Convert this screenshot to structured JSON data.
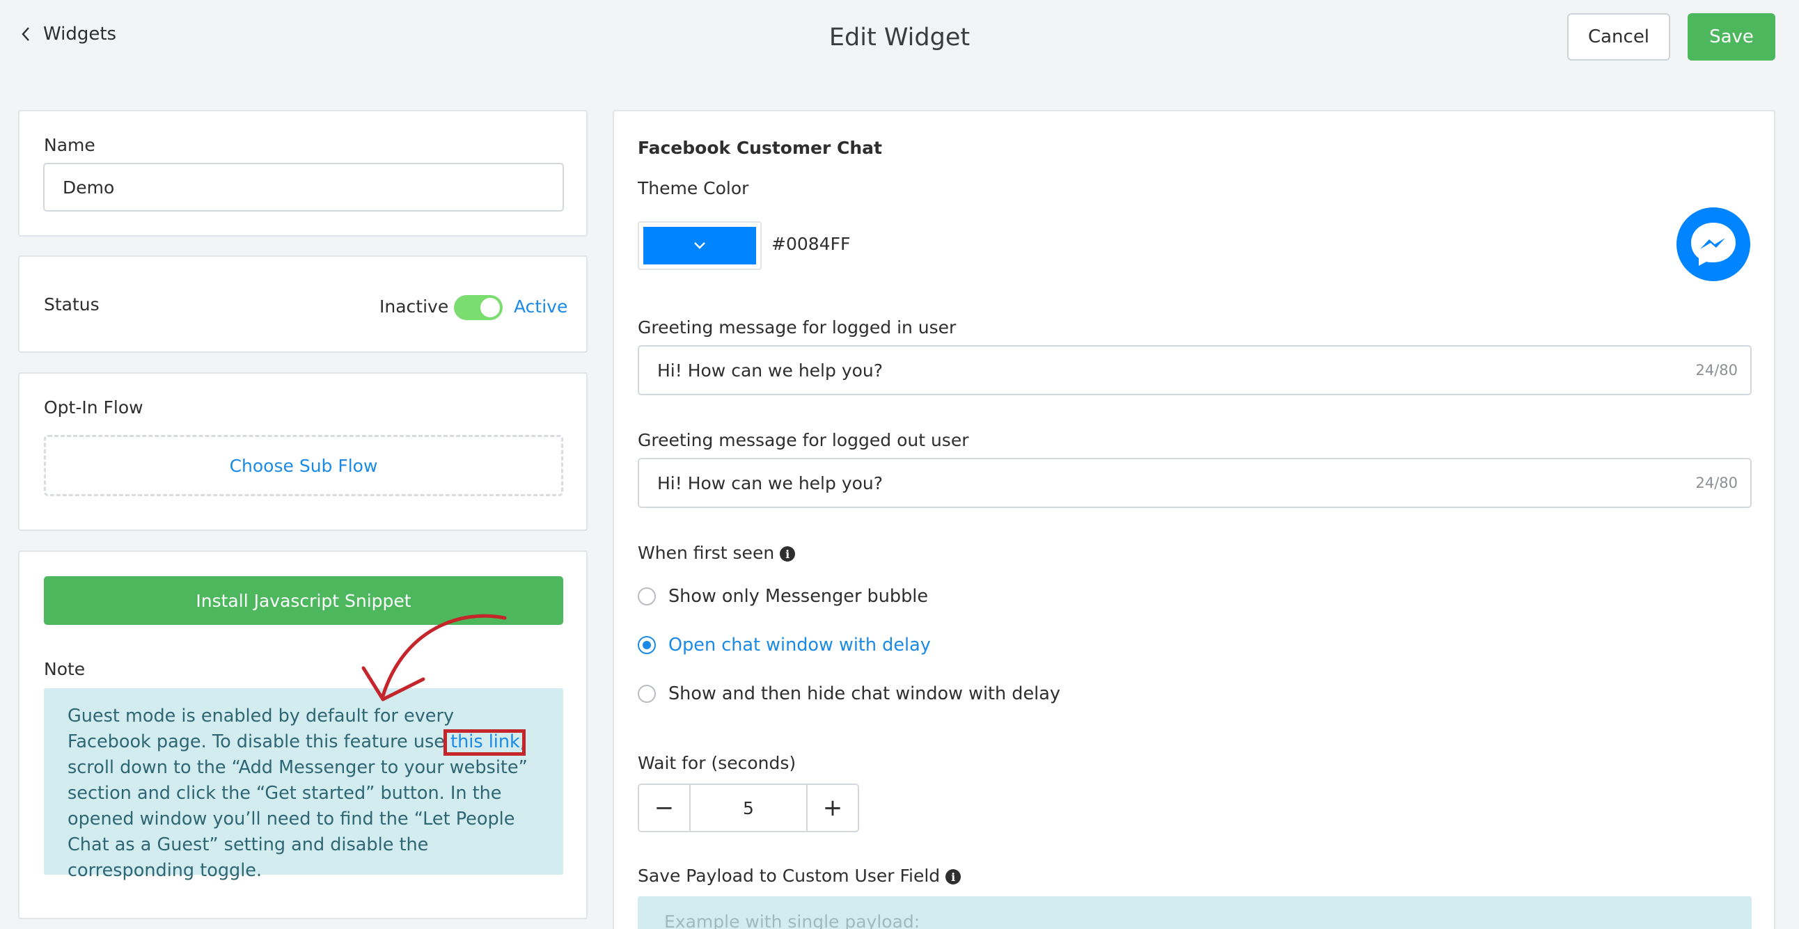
{
  "header": {
    "back_label": "Widgets",
    "title": "Edit Widget",
    "cancel_label": "Cancel",
    "save_label": "Save"
  },
  "name_card": {
    "label": "Name",
    "value": "Demo"
  },
  "status_card": {
    "label": "Status",
    "inactive_label": "Inactive",
    "active_label": "Active",
    "is_active": true
  },
  "optin_card": {
    "label": "Opt-In Flow",
    "choose_label": "Choose Sub Flow"
  },
  "install_card": {
    "install_button_label": "Install Javascript Snippet",
    "note_label": "Note",
    "note_text_before": "Guest mode is enabled by default for every Facebook page. To disable this feature use ",
    "note_link_text": "this link",
    "note_text_after": ", scroll down to the “Add Messenger to your website” section and click the “Get started” button. In the opened window you’ll need to find the “Let People Chat as a Guest” setting and disable the corresponding toggle."
  },
  "fb_chat": {
    "section_title": "Facebook Customer Chat",
    "theme_color_label": "Theme Color",
    "theme_color_hex": "#0084FF",
    "greeting_logged_in_label": "Greeting message for logged in user",
    "greeting_logged_in_value": "Hi! How can we help you?",
    "greeting_logged_in_counter": "24/80",
    "greeting_logged_out_label": "Greeting message for logged out user",
    "greeting_logged_out_value": "Hi! How can we help you?",
    "greeting_logged_out_counter": "24/80",
    "first_seen_label": "When first seen",
    "first_seen_options": [
      {
        "label": "Show only Messenger bubble",
        "selected": false
      },
      {
        "label": "Open chat window with delay",
        "selected": true
      },
      {
        "label": "Show and then hide chat window with delay",
        "selected": false
      }
    ],
    "wait_label": "Wait for (seconds)",
    "wait_value": "5",
    "wait_minus": "−",
    "wait_plus": "+",
    "payload_label": "Save Payload to Custom User Field",
    "payload_placeholder": "Example with single payload:"
  },
  "colors": {
    "accent_blue": "#1a8ae6",
    "messenger_blue": "#0084ff",
    "save_green": "#4cb75c",
    "toggle_green": "#7bdc6f",
    "note_bg": "#d2ecf0",
    "annotation_red": "#c4262c"
  },
  "icons": {
    "back": "chevron-left-icon",
    "swatch": "chevron-down-icon",
    "messenger": "messenger-icon",
    "info": "info-icon"
  }
}
